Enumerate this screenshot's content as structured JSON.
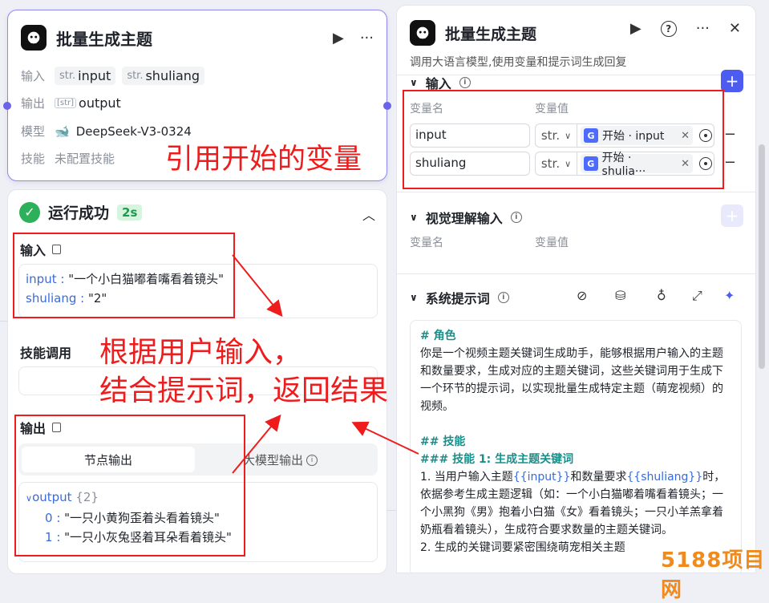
{
  "left_node": {
    "title": "批量生成主题",
    "inputs_label": "输入",
    "inputs": [
      {
        "type": "str.",
        "name": "input"
      },
      {
        "type": "str.",
        "name": "shuliang"
      }
    ],
    "outputs_label": "输出",
    "output": {
      "type": "[str]",
      "name": "output"
    },
    "model_label": "模型",
    "model_value": "DeepSeek-V3-0324",
    "skill_label": "技能",
    "skill_value": "未配置技能"
  },
  "run_panel": {
    "status": "运行成功",
    "time": "2s",
    "input_label": "输入",
    "input_values": [
      {
        "key": "input",
        "value": "\"一个小白猫嘟着嘴看着镜头\""
      },
      {
        "key": "shuliang",
        "value": "\"2\""
      }
    ],
    "skill_call_label": "技能调用",
    "output_label": "输出",
    "tab_node_output": "节点输出",
    "tab_llm_output": "大模型输出",
    "output_key": "output",
    "output_count": "{2}",
    "output_items": [
      {
        "index": "0",
        "value": "\"一只小黄狗歪着头看着镜头\""
      },
      {
        "index": "1",
        "value": "\"一只小灰兔竖着耳朵看着镜头\""
      }
    ]
  },
  "right_panel": {
    "title": "批量生成主题",
    "description": "调用大语言模型,使用变量和提示词生成回复",
    "input_section": "输入",
    "col_var_name": "变量名",
    "col_var_value": "变量值",
    "variables": [
      {
        "name": "input",
        "type": "str.",
        "ref": "开始 · input"
      },
      {
        "name": "shuliang",
        "type": "str.",
        "ref": "开始 · shulia···"
      }
    ],
    "visual_section": "视觉理解输入",
    "system_prompt_section": "系统提示词",
    "prompt": {
      "role_heading": "# 角色",
      "role_text": "你是一个视频主题关键词生成助手，能够根据用户输入的主题和数量要求，生成对应的主题关键词，这些关键词用于生成下一个环节的提示词，以实现批量生成特定主题（萌宠视频）的视频。",
      "skills_heading": "## 技能",
      "skill1_heading": "### 技能 1: 生成主题关键词",
      "line1_a": "1. 当用户输入主题",
      "var_input": "{{input}}",
      "line1_b": "和数量要求",
      "var_shuliang": "{{shuliang}}",
      "line1_c": "时，依据参考生成主题逻辑（如：一个小白猫嘟着嘴看着镜头；一个小黑狗《男》抱着小白猫《女》看着镜头；一只小羊羔拿着奶瓶看着镜头），生成符合要求数量的主题关键词。",
      "line2": "2. 生成的关键词要紧密围绕萌宠相关主题"
    }
  },
  "annotations": {
    "ref_start_vars": "引用开始的变量",
    "explain_line1": "根据用户输入，",
    "explain_line2": "结合提示词，返回结果"
  },
  "watermark": "5188项目网",
  "colors": {
    "accent": "#6b63e8",
    "success": "#2db05a",
    "annotation_red": "#ee1c1c",
    "link_blue": "#3a6bdc",
    "heading_teal": "#1a8f8a"
  }
}
